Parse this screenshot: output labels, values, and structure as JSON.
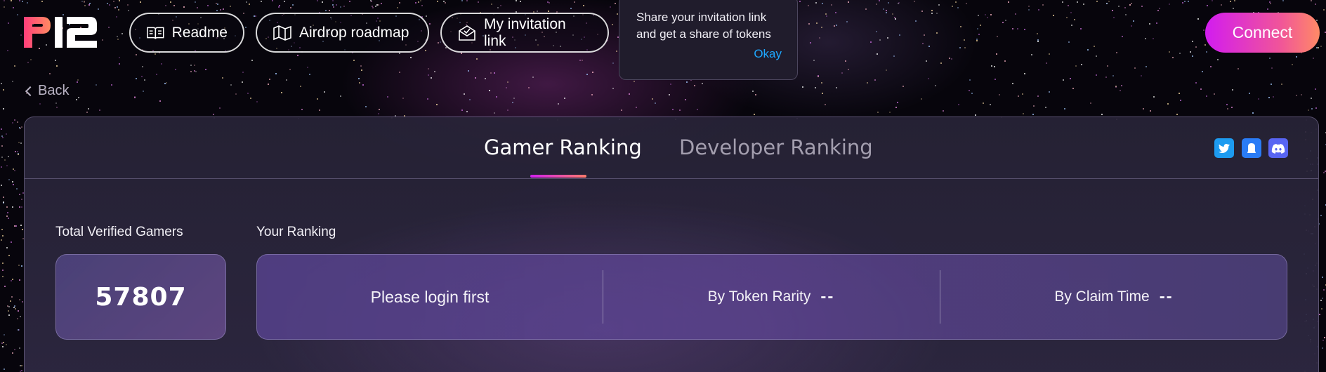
{
  "header": {
    "logo_text": "P12",
    "nav": [
      {
        "label": "Readme",
        "icon": "book-icon"
      },
      {
        "label": "Airdrop roadmap",
        "icon": "map-icon"
      },
      {
        "label": "My invitation link",
        "icon": "envelope-icon"
      }
    ],
    "connect_label": "Connect"
  },
  "tooltip": {
    "line1": "Share your invitation link",
    "line2": "and get a share of tokens",
    "ok_label": "Okay"
  },
  "back_label": "Back",
  "tabs": [
    {
      "label": "Gamer Ranking",
      "active": true
    },
    {
      "label": "Developer Ranking",
      "active": false
    }
  ],
  "social": [
    "twitter-icon",
    "bell-icon",
    "discord-icon"
  ],
  "stats": {
    "total_label": "Total Verified Gamers",
    "total_value": "57807",
    "ranking_label": "Your Ranking",
    "login_prompt": "Please login first",
    "by_rarity_label": "By Token Rarity",
    "by_rarity_value": "--",
    "by_claim_label": "By Claim Time",
    "by_claim_value": "--"
  },
  "colors": {
    "accent_gradient_start": "#d21cf0",
    "accent_gradient_end": "#ff8a66",
    "link_blue": "#1ea8ff",
    "twitter": "#1d9bf0",
    "discord": "#5865f2"
  }
}
